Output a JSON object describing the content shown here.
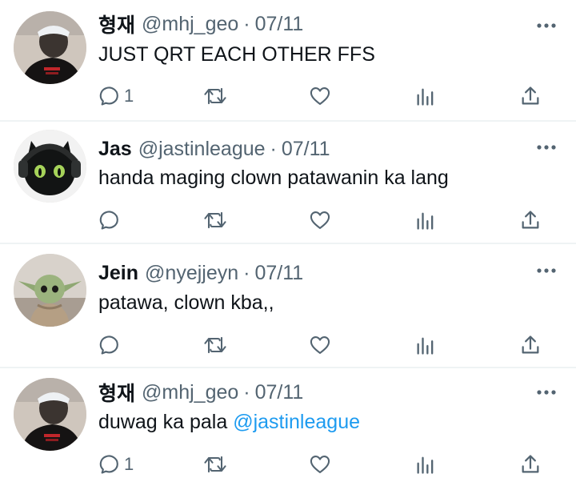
{
  "tweets": [
    {
      "name": "형재",
      "handle": "@mhj_geo",
      "separator": "·",
      "date": "07/11",
      "text": "JUST QRT EACH OTHER FFS",
      "mention": "",
      "reply_count": "1",
      "avatar": "person-black-shirt-bucket-hat"
    },
    {
      "name": "Jas",
      "handle": "@jastinleague",
      "separator": "·",
      "date": "07/11",
      "text": "handa maging clown patawanin ka lang",
      "mention": "",
      "reply_count": "",
      "avatar": "toothless-dragon-with-headphones"
    },
    {
      "name": "Jein",
      "handle": "@nyejjeyn",
      "separator": "·",
      "date": "07/11",
      "text": "patawa, clown kba,,",
      "mention": "",
      "reply_count": "",
      "avatar": "baby-yoda-figure"
    },
    {
      "name": "형재",
      "handle": "@mhj_geo",
      "separator": "·",
      "date": "07/11",
      "text": "duwag ka pala ",
      "mention": "@jastinleague",
      "reply_count": "1",
      "avatar": "person-black-shirt-bucket-hat"
    }
  ],
  "icons": {
    "reply": "reply-icon",
    "retweet": "retweet-icon",
    "like": "like-icon",
    "views": "views-icon",
    "share": "share-icon",
    "more": "more-icon"
  },
  "colors": {
    "text": "#0f1419",
    "secondary": "#536471",
    "link": "#1d9bf0",
    "divider": "#eff3f4"
  }
}
